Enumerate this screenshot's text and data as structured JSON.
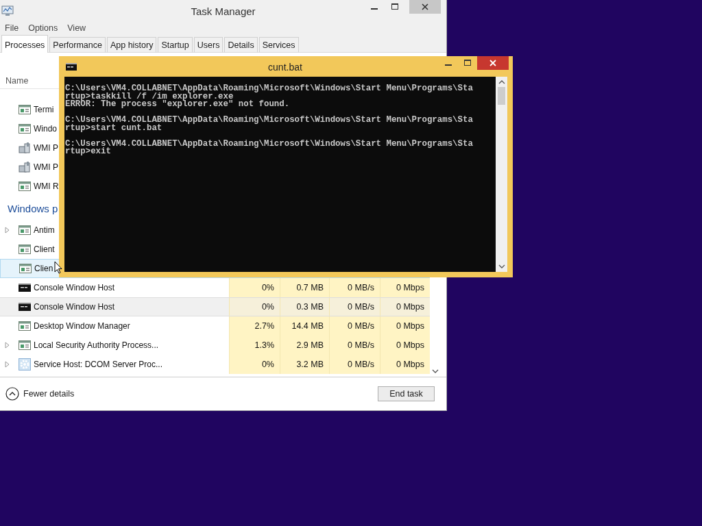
{
  "task_manager": {
    "title": "Task Manager",
    "menu": [
      {
        "label": "File"
      },
      {
        "label": "Options"
      },
      {
        "label": "View"
      }
    ],
    "tabs": [
      {
        "label": "Processes",
        "selected": true
      },
      {
        "label": "Performance",
        "selected": false
      },
      {
        "label": "App history",
        "selected": false
      },
      {
        "label": "Startup",
        "selected": false
      },
      {
        "label": "Users",
        "selected": false
      },
      {
        "label": "Details",
        "selected": false
      },
      {
        "label": "Services",
        "selected": false
      }
    ],
    "name_header": "Name",
    "rows": [
      {
        "kind": "app",
        "name": "Termi",
        "expandable": false,
        "selected": false,
        "hovered": false
      },
      {
        "kind": "app",
        "name": "Windo",
        "expandable": false,
        "selected": false,
        "hovered": false
      },
      {
        "kind": "wmi",
        "name": "WMI P",
        "expandable": false,
        "selected": false,
        "hovered": false
      },
      {
        "kind": "wmi",
        "name": "WMI P",
        "expandable": false,
        "selected": false,
        "hovered": false
      },
      {
        "kind": "app",
        "name": "WMI R",
        "expandable": false,
        "selected": false,
        "hovered": false
      },
      {
        "kind": "group",
        "name": "Windows p"
      },
      {
        "kind": "app",
        "name": "Antim",
        "expandable": true,
        "selected": false,
        "hovered": false
      },
      {
        "kind": "app",
        "name": "Client",
        "expandable": false,
        "selected": false,
        "hovered": false
      },
      {
        "kind": "app",
        "name": "Clien",
        "expandable": false,
        "selected": false,
        "hovered": true
      },
      {
        "kind": "console",
        "name": "Console Window Host",
        "expandable": false,
        "selected": false,
        "hovered": false,
        "cpu": "0%",
        "memory": "0.7 MB",
        "disk": "0 MB/s",
        "network": "0 Mbps"
      },
      {
        "kind": "console",
        "name": "Console Window Host",
        "expandable": false,
        "selected": true,
        "hovered": false,
        "cpu": "0%",
        "memory": "0.3 MB",
        "disk": "0 MB/s",
        "network": "0 Mbps"
      },
      {
        "kind": "app",
        "name": "Desktop Window Manager",
        "expandable": false,
        "selected": false,
        "hovered": false,
        "cpu": "2.7%",
        "memory": "14.4 MB",
        "disk": "0 MB/s",
        "network": "0 Mbps"
      },
      {
        "kind": "app",
        "name": "Local Security Authority Process...",
        "expandable": true,
        "selected": false,
        "hovered": false,
        "cpu": "1.3%",
        "memory": "2.9 MB",
        "disk": "0 MB/s",
        "network": "0 Mbps"
      },
      {
        "kind": "service",
        "name": "Service Host: DCOM Server Proc...",
        "expandable": true,
        "selected": false,
        "hovered": false,
        "cpu": "0%",
        "memory": "3.2 MB",
        "disk": "0 MB/s",
        "network": "0 Mbps"
      }
    ],
    "fewer_details": "Fewer details",
    "end_task": "End task"
  },
  "console": {
    "title": "cunt.bat",
    "blocks": [
      [
        "C:\\Users\\VM4.COLLABNET\\AppData\\Roaming\\Microsoft\\Windows\\Start Menu\\Programs\\Sta",
        "rtup>taskkill /f /im explorer.exe",
        "ERROR: The process \"explorer.exe\" not found."
      ],
      [
        "C:\\Users\\VM4.COLLABNET\\AppData\\Roaming\\Microsoft\\Windows\\Start Menu\\Programs\\Sta",
        "rtup>start cunt.bat"
      ],
      [
        "C:\\Users\\VM4.COLLABNET\\AppData\\Roaming\\Microsoft\\Windows\\Start Menu\\Programs\\Sta",
        "rtup>exit"
      ]
    ]
  }
}
